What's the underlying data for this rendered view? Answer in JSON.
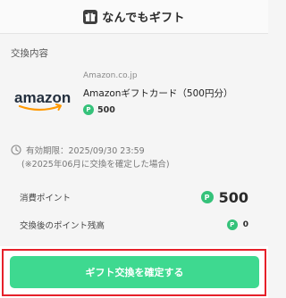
{
  "header": {
    "app_title": "なんでもギフト",
    "logo_icon": "gift-logo-icon"
  },
  "section": {
    "title": "交換内容"
  },
  "product": {
    "logo_text": "amazon",
    "seller": "Amazon.co.jp",
    "name": "Amazonギフトカード（500円分）",
    "point_badge": "P",
    "price_points": "500"
  },
  "expiry": {
    "icon": "clock-icon",
    "label": "有効期限：2025/09/30 23:59",
    "note": "(※2025年06月に交換を確定した場合)"
  },
  "summary": {
    "consumed_label": "消費ポイント",
    "consumed_badge": "P",
    "consumed_value": "500",
    "remaining_label": "交換後のポイント残高",
    "remaining_badge": "P",
    "remaining_value": "0"
  },
  "action": {
    "confirm_label": "ギフト交換を確定する"
  },
  "colors": {
    "accent_green": "#3ed990",
    "point_green": "#35c27a",
    "highlight_red": "#e6202a",
    "amazon_orange": "#ff9900"
  }
}
